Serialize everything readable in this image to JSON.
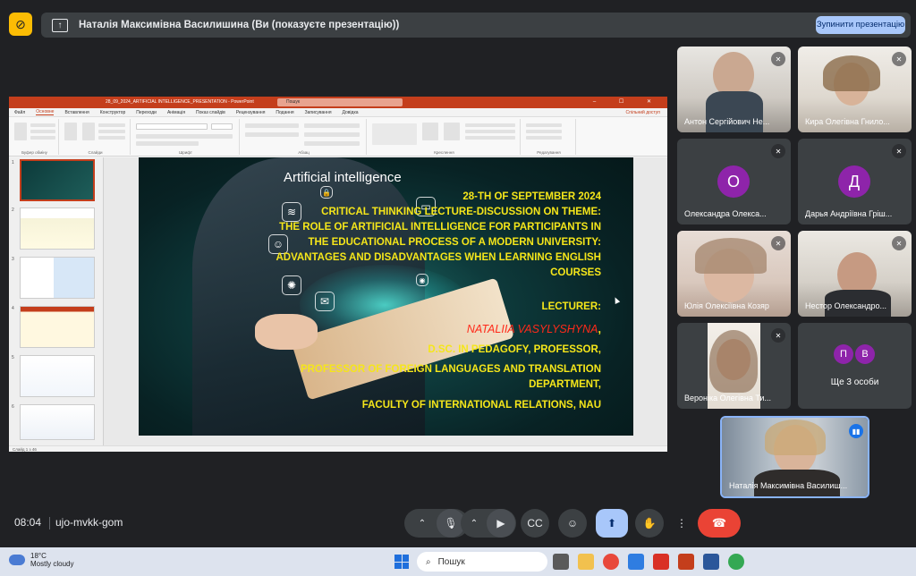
{
  "top_bar": {
    "present_icon": "presentation-off-icon",
    "banner_text": "Наталія Максимівна Василишина (Ви (показуєте презентацію))",
    "stop_button": "Зупинити презентацію"
  },
  "powerpoint": {
    "title": "28_09_2024_ARTIFICIAL INTELLIGENCE_PRESENTATION - PowerPoint",
    "search_placeholder": "Пошук",
    "menu": [
      "Файл",
      "Основне",
      "Вставлення",
      "Конструктор",
      "Переходи",
      "Анімація",
      "Показ слайдів",
      "Рецензування",
      "Подання",
      "Записування",
      "Довідка"
    ],
    "active_menu": "Основне",
    "share": "Спільний доступ",
    "ribbon_groups": [
      "Буфер обміну",
      "Слайди",
      "Шрифт",
      "Абзац",
      "Креслення",
      "Редагування"
    ],
    "status": "Слайд 1 з 46",
    "thumb_numbers": [
      "1",
      "2",
      "3",
      "4",
      "5",
      "6"
    ],
    "slide": {
      "heading": "Artificial intelligence",
      "date": "28-TH OF SEPTEMBER 2024",
      "lecture": "CRITICAL THINKING LECTURE-DISCUSSION ON THEME:",
      "theme_1": "THE ROLE OF ARTIFICIAL INTELLIGENCE FOR PARTICIPANTS IN",
      "theme_2": "THE EDUCATIONAL PROCESS OF A MODERN UNIVERSITY:",
      "theme_3": "ADVANTAGES AND DISADVANTAGES WHEN LEARNING ENGLISH",
      "theme_4": "COURSES",
      "lecturer_label": "LECTURER:",
      "lecturer_name": "NATALIIA VASYLYSHYNA",
      "comma": ",",
      "degree": "D.SC. IN PEDAGOFY, PROFESSOR,",
      "position_1": "PROFESSOR OF FOREIGN LANGUAGES AND TRANSLATION",
      "position_2": "DEPARTMENT,",
      "faculty": "FACULTY OF INTERNATIONAL RELATIONS, NAU"
    }
  },
  "participants": [
    {
      "name": "Антон Сергійович Не...",
      "avatar": "",
      "muted": true
    },
    {
      "name": "Кира Олегівна Гнило...",
      "avatar": "",
      "muted": true
    },
    {
      "name": "Олександра Олекса...",
      "avatar": "О",
      "avatar_color": "#8e24aa",
      "muted": true
    },
    {
      "name": "Дарья Андріївна Гріш...",
      "avatar": "Д",
      "avatar_color": "#8e24aa",
      "muted": true
    },
    {
      "name": "Юлія Олексіївна Козяр",
      "avatar": "",
      "muted": true
    },
    {
      "name": "Нестор Олександро...",
      "avatar": "",
      "muted": true
    },
    {
      "name": "Вероніка Олегівна Ти...",
      "avatar": "",
      "muted": true
    },
    {
      "name": "Ще 3 особи",
      "letters": [
        "П",
        "В"
      ],
      "letter_colors": [
        "#8e24aa",
        "#8e24aa"
      ]
    },
    {
      "name": "Наталія Максимівна Василиш...",
      "speaking": true
    }
  ],
  "bottom_bar": {
    "time": "08:04",
    "meeting_code": "ujo-mvkk-gom"
  },
  "taskbar": {
    "temperature": "18°C",
    "weather": "Mostly cloudy",
    "search": "Пошук"
  }
}
